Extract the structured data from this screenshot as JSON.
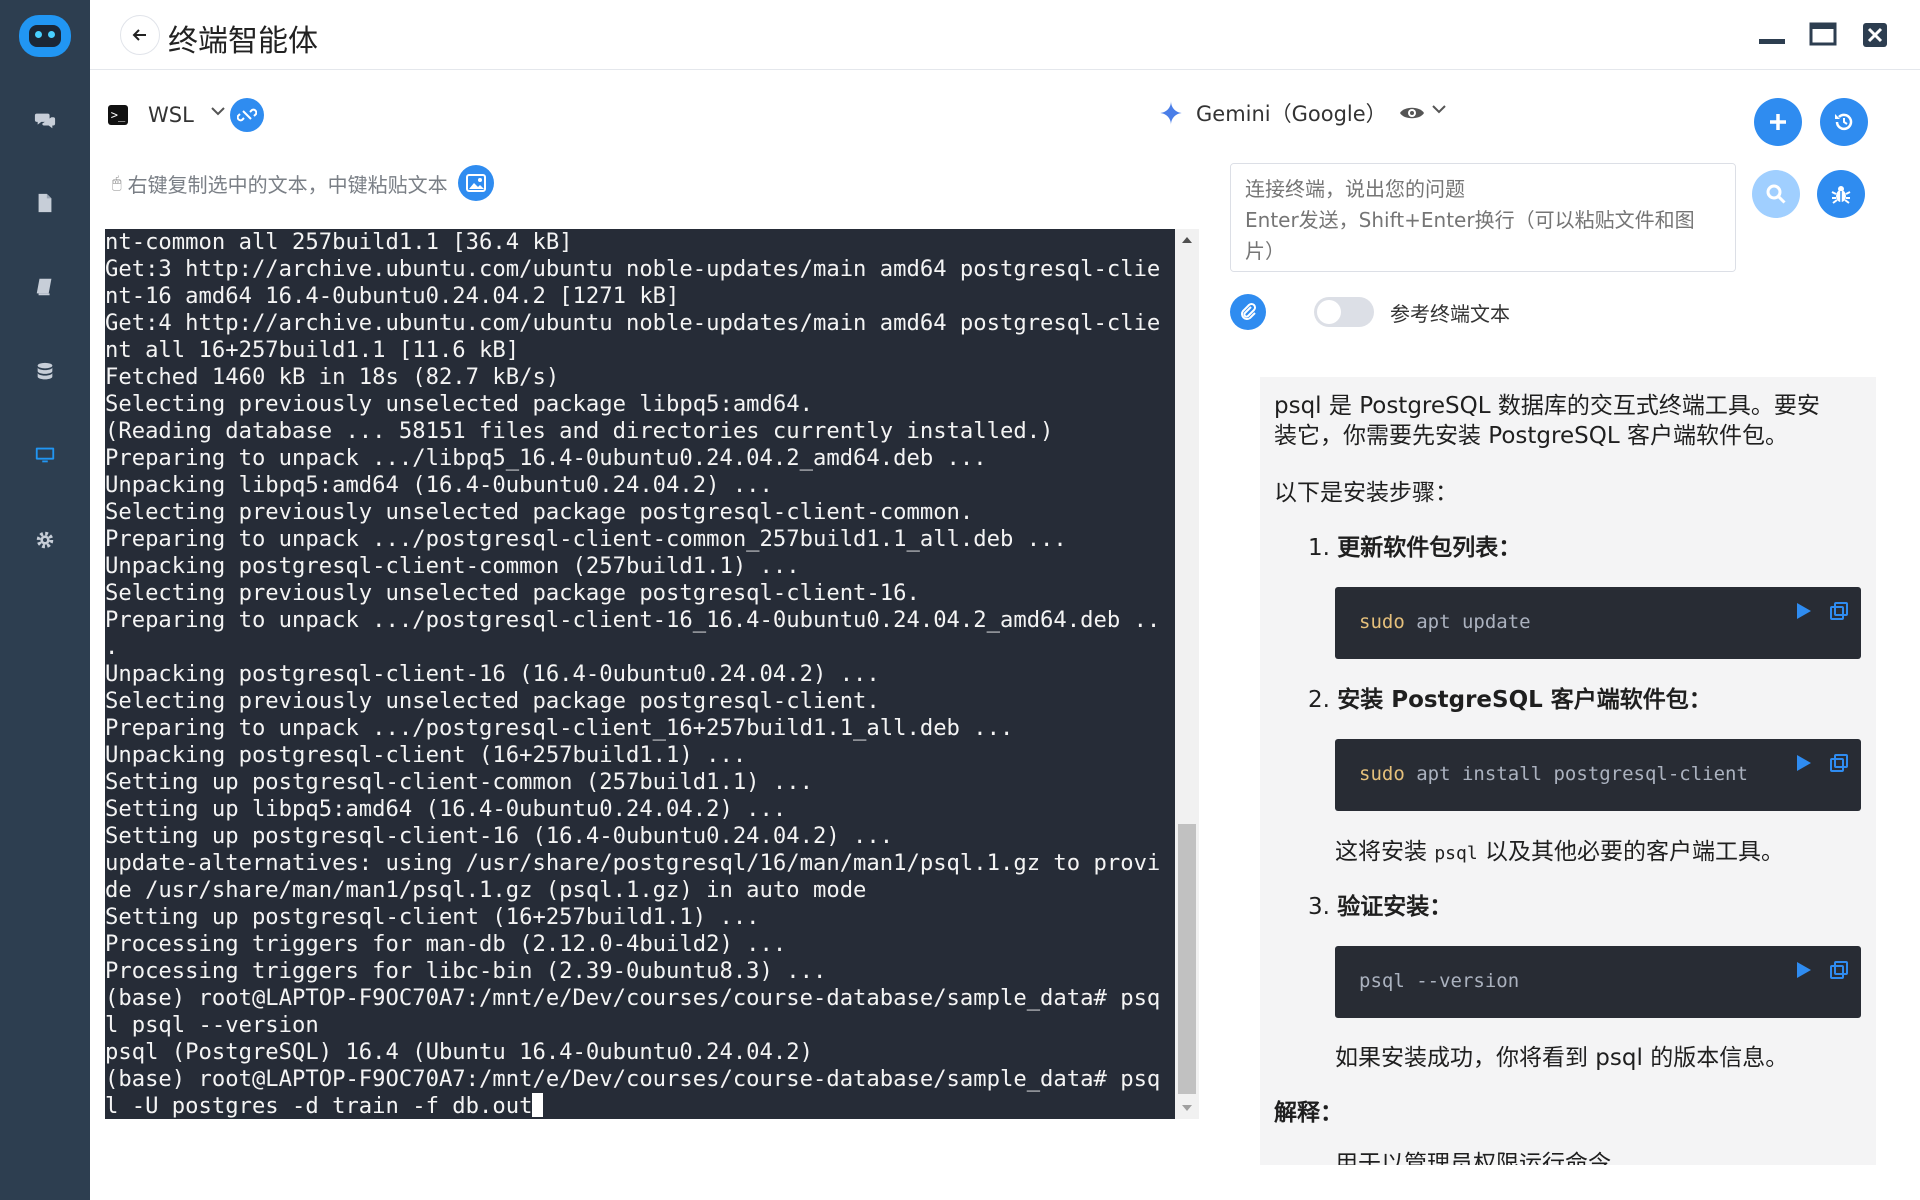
{
  "app": {
    "title": "终端智能体"
  },
  "colors": {
    "sidebar": "#2d3e50",
    "accent": "#2f8cf0",
    "terminal_bg": "#262c37",
    "code_bg": "#282c34",
    "code_keyword": "#e5c07b"
  },
  "sidebar": {
    "items": [
      {
        "icon": "chat-icon"
      },
      {
        "icon": "document-icon"
      },
      {
        "icon": "book-icon"
      },
      {
        "icon": "database-icon"
      },
      {
        "icon": "monitor-icon",
        "active": true
      },
      {
        "icon": "gear-icon"
      }
    ]
  },
  "window_controls": [
    "minimize-icon",
    "maximize-icon",
    "close-icon"
  ],
  "terminal_toolbar": {
    "terminal_name": "WSL"
  },
  "hint": {
    "text": "右键复制选中的文本，中键粘贴文本"
  },
  "terminal": {
    "lines": [
      "nt-common all 257build1.1 [36.4 kB]",
      "Get:3 http://archive.ubuntu.com/ubuntu noble-updates/main amd64 postgresql-clie",
      "nt-16 amd64 16.4-0ubuntu0.24.04.2 [1271 kB]",
      "Get:4 http://archive.ubuntu.com/ubuntu noble-updates/main amd64 postgresql-clie",
      "nt all 16+257build1.1 [11.6 kB]",
      "Fetched 1460 kB in 18s (82.7 kB/s)",
      "Selecting previously unselected package libpq5:amd64.",
      "(Reading database ... 58151 files and directories currently installed.)",
      "Preparing to unpack .../libpq5_16.4-0ubuntu0.24.04.2_amd64.deb ...",
      "Unpacking libpq5:amd64 (16.4-0ubuntu0.24.04.2) ...",
      "Selecting previously unselected package postgresql-client-common.",
      "Preparing to unpack .../postgresql-client-common_257build1.1_all.deb ...",
      "Unpacking postgresql-client-common (257build1.1) ...",
      "Selecting previously unselected package postgresql-client-16.",
      "Preparing to unpack .../postgresql-client-16_16.4-0ubuntu0.24.04.2_amd64.deb ..",
      ".",
      "Unpacking postgresql-client-16 (16.4-0ubuntu0.24.04.2) ...",
      "Selecting previously unselected package postgresql-client.",
      "Preparing to unpack .../postgresql-client_16+257build1.1_all.deb ...",
      "Unpacking postgresql-client (16+257build1.1) ...",
      "Setting up postgresql-client-common (257build1.1) ...",
      "Setting up libpq5:amd64 (16.4-0ubuntu0.24.04.2) ...",
      "Setting up postgresql-client-16 (16.4-0ubuntu0.24.04.2) ...",
      "update-alternatives: using /usr/share/postgresql/16/man/man1/psql.1.gz to provi",
      "de /usr/share/man/man1/psql.1.gz (psql.1.gz) in auto mode",
      "Setting up postgresql-client (16+257build1.1) ...",
      "Processing triggers for man-db (2.12.0-4build2) ...",
      "Processing triggers for libc-bin (2.39-0ubuntu8.3) ...",
      "(base) root@LAPTOP-F9OC70A7:/mnt/e/Dev/courses/course-database/sample_data# psq",
      "l psql --version",
      "psql (PostgreSQL) 16.4 (Ubuntu 16.4-0ubuntu0.24.04.2)",
      "(base) root@LAPTOP-F9OC70A7:/mnt/e/Dev/courses/course-database/sample_data# psq",
      "l -U postgres -d train -f db.out"
    ]
  },
  "model": {
    "name": "Gemini（Google）"
  },
  "chat_input": {
    "placeholder": "连接终端，说出您的问题\nEnter发送，Shift+Enter换行（可以粘贴文件和图片）"
  },
  "toggle": {
    "label": "参考终端文本",
    "on": false
  },
  "answer": {
    "intro": "psql 是 PostgreSQL 数据库的交互式终端工具。要安装它，你需要先安装 PostgreSQL 客户端软件包。",
    "steps_heading": "以下是安装步骤：",
    "steps": [
      {
        "num": "1.",
        "title": "更新软件包列表：",
        "code_kw": "sudo",
        "code_rest": " apt update",
        "note": ""
      },
      {
        "num": "2.",
        "title": "安装 PostgreSQL 客户端软件包：",
        "code_kw": "sudo",
        "code_rest": " apt install postgresql-client",
        "note_pre": "这将安装 ",
        "note_code": "psql",
        "note_post": " 以及其他必要的客户端工具。"
      },
      {
        "num": "3.",
        "title": "验证安装：",
        "code_kw": "",
        "code_rest": "psql --version",
        "note": "如果安装成功，你将看到 psql 的版本信息。"
      }
    ],
    "explain_heading": "解释：",
    "explain_partial": "用于以管理员权限运行命令"
  }
}
